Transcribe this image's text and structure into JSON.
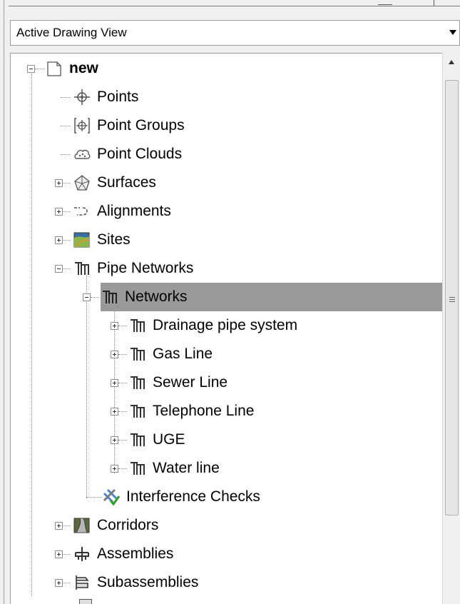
{
  "dropdown": {
    "value": "Active Drawing View"
  },
  "tree": {
    "root": {
      "label": "new"
    },
    "items": [
      {
        "label": "Points"
      },
      {
        "label": "Point Groups"
      },
      {
        "label": "Point Clouds"
      },
      {
        "label": "Surfaces"
      },
      {
        "label": "Alignments"
      },
      {
        "label": "Sites"
      },
      {
        "label": "Pipe Networks"
      },
      {
        "label": "Networks"
      },
      {
        "label": "Drainage pipe system"
      },
      {
        "label": "Gas Line"
      },
      {
        "label": "Sewer Line"
      },
      {
        "label": "Telephone Line"
      },
      {
        "label": "UGE"
      },
      {
        "label": "Water line"
      },
      {
        "label": "Interference Checks"
      },
      {
        "label": "Corridors"
      },
      {
        "label": "Assemblies"
      },
      {
        "label": "Subassemblies"
      }
    ]
  },
  "colors": {
    "selection": "#999999",
    "background": "#ffffff",
    "panel": "#f0f0f0"
  }
}
